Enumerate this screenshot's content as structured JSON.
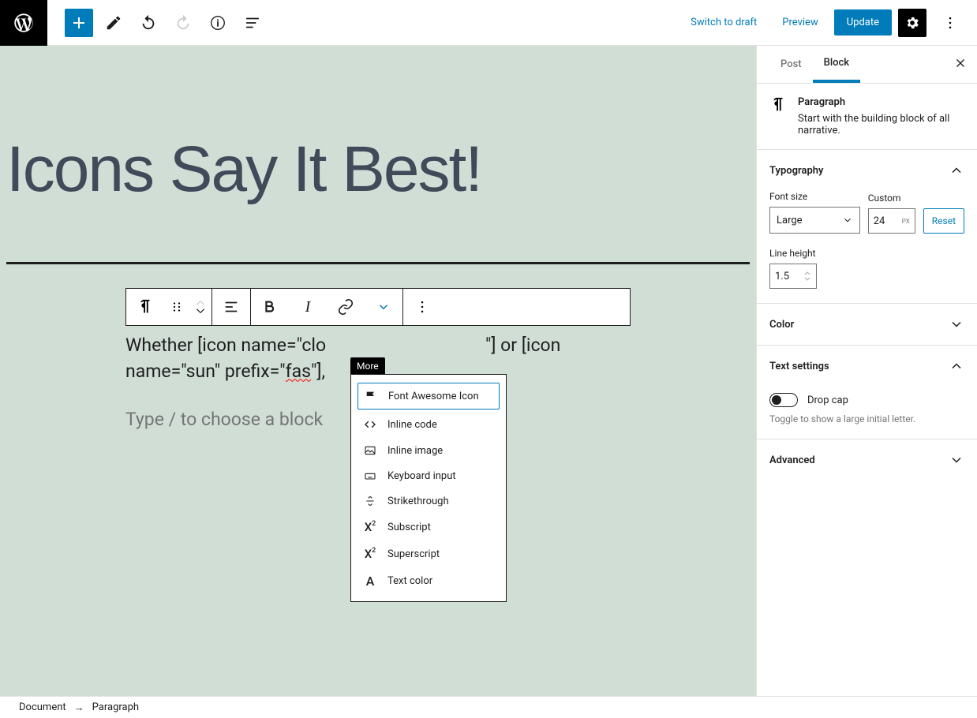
{
  "top": {
    "switch_draft": "Switch to draft",
    "preview": "Preview",
    "update": "Update"
  },
  "canvas": {
    "title": "Icons Say It Best!",
    "paragraph": "Whether [icon name=\"clo",
    "paragraph_end": "\"] or [icon name=\"sun\" prefix=\"",
    "underlined": "fas",
    "paragraph_tail": "\"],",
    "placeholder": "Type / to choose a block"
  },
  "more_tooltip": "More",
  "dropdown": {
    "items": [
      {
        "label": "Font Awesome Icon"
      },
      {
        "label": "Inline code"
      },
      {
        "label": "Inline image"
      },
      {
        "label": "Keyboard input"
      },
      {
        "label": "Strikethrough"
      },
      {
        "label": "Subscript"
      },
      {
        "label": "Superscript"
      },
      {
        "label": "Text color"
      }
    ]
  },
  "sidebar": {
    "tabs": {
      "post": "Post",
      "block": "Block"
    },
    "block_title": "Paragraph",
    "block_desc": "Start with the building block of all narrative.",
    "typography": {
      "title": "Typography",
      "font_size_label": "Font size",
      "font_size_value": "Large",
      "custom_label": "Custom",
      "custom_value": "24",
      "custom_unit": "PX",
      "reset": "Reset",
      "line_height_label": "Line height",
      "line_height_value": "1.5"
    },
    "color": {
      "title": "Color"
    },
    "text_settings": {
      "title": "Text settings",
      "drop_cap": "Drop cap",
      "hint": "Toggle to show a large initial letter."
    },
    "advanced": {
      "title": "Advanced"
    }
  },
  "breadcrumb": {
    "document": "Document",
    "paragraph": "Paragraph"
  }
}
